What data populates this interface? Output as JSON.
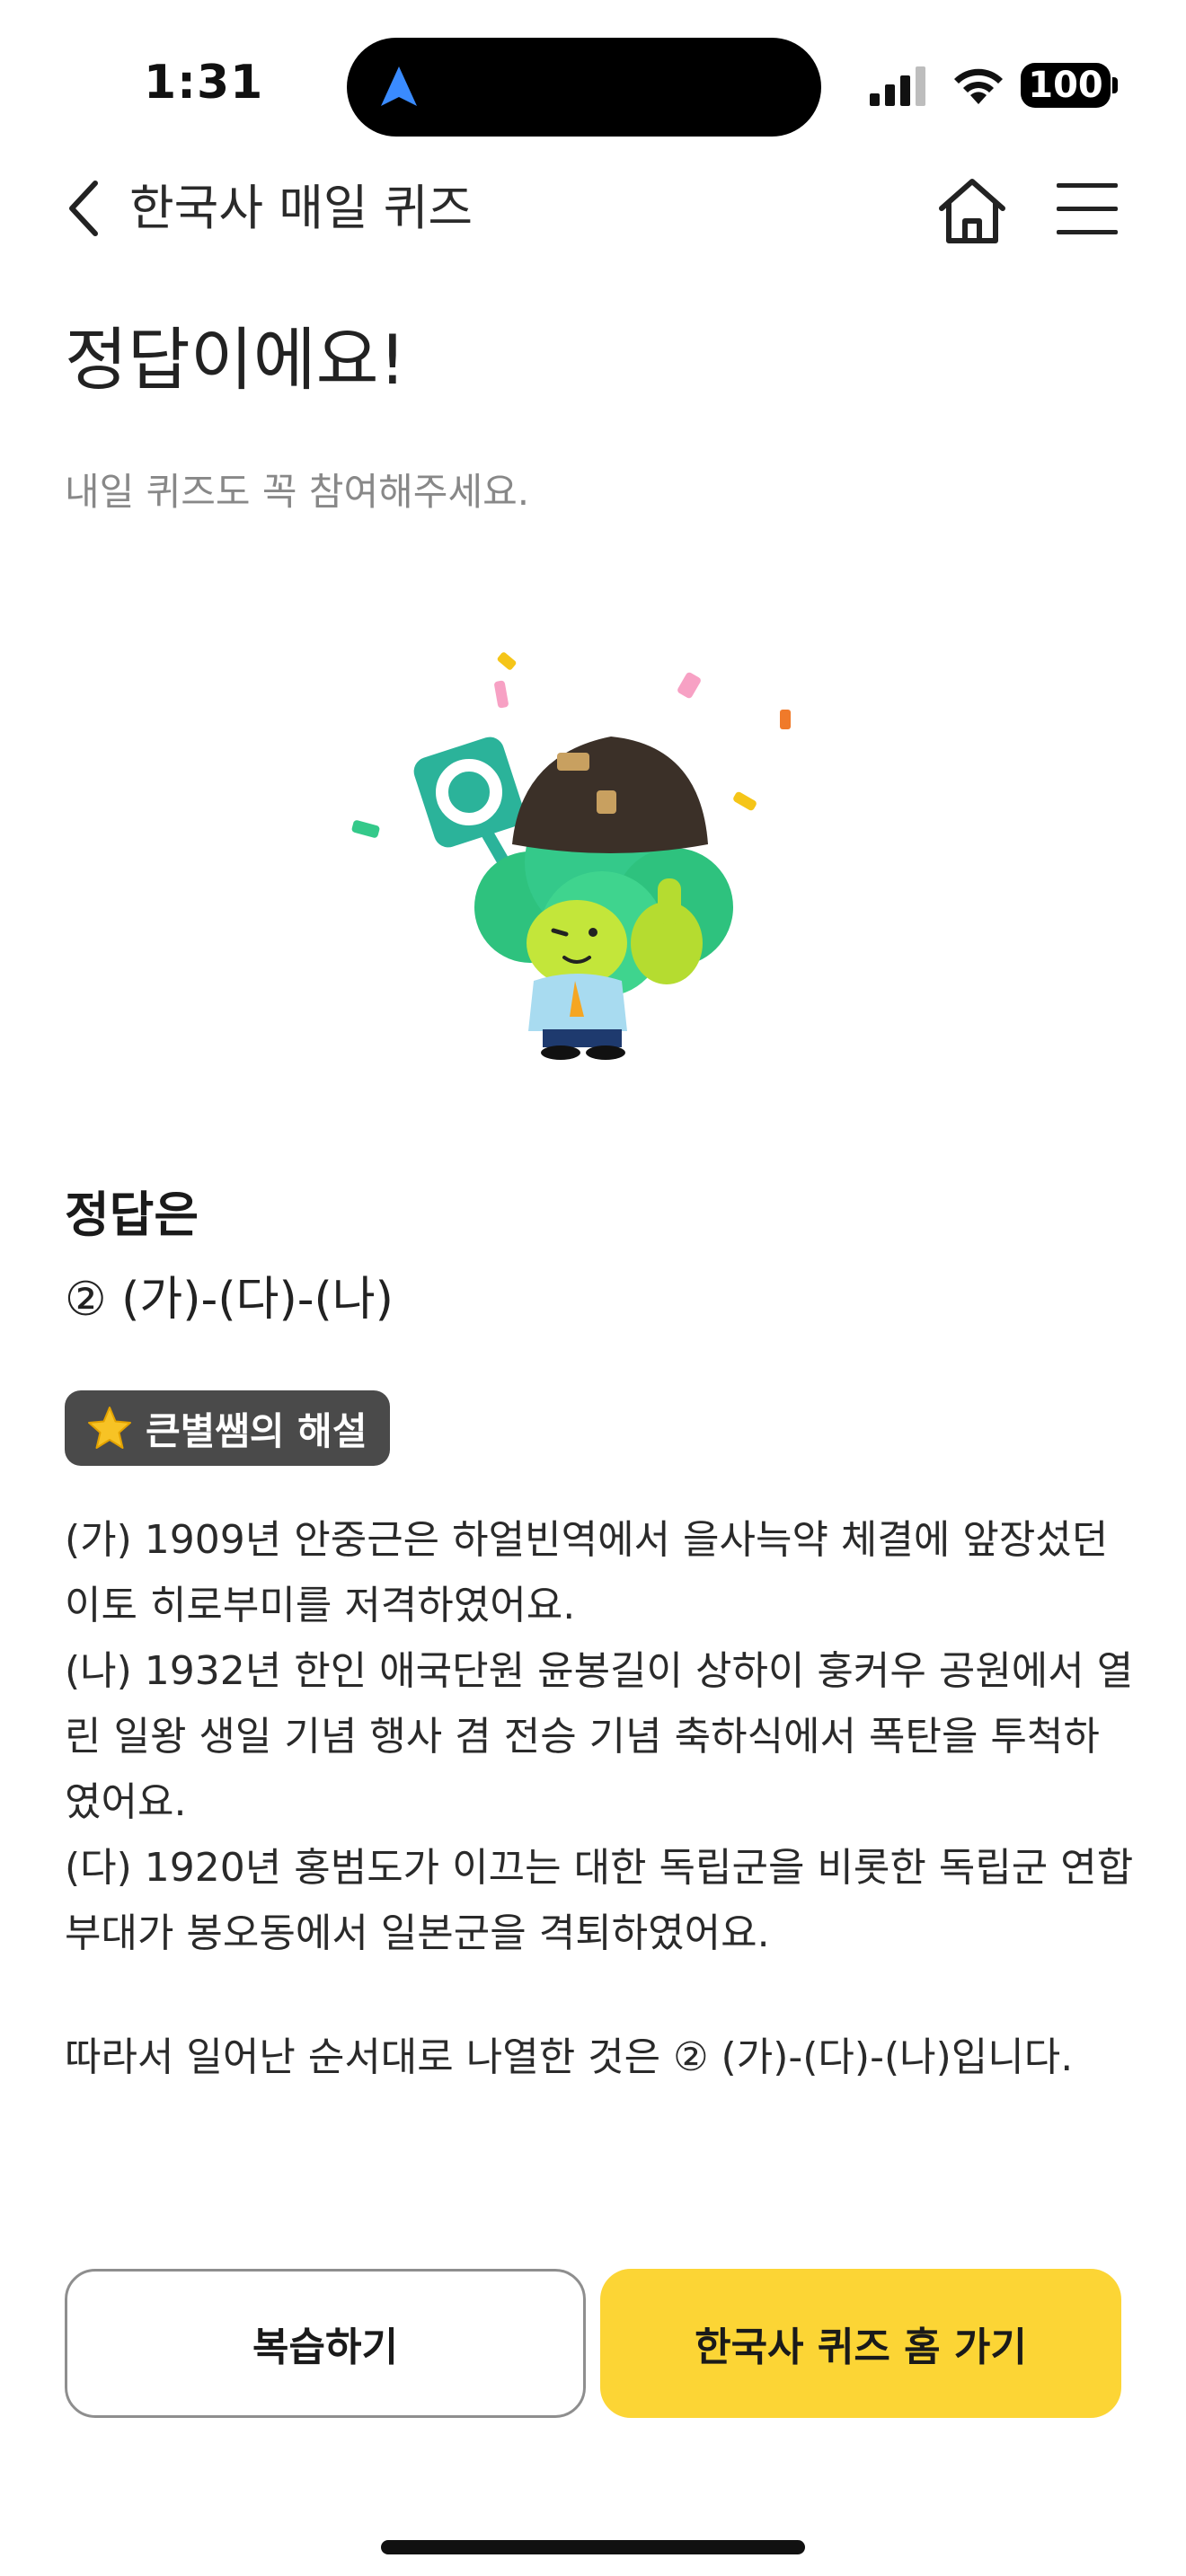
{
  "status_bar": {
    "time": "1:31",
    "battery": "100",
    "icons": [
      "navigation-arrow-icon",
      "signal-bars-icon",
      "wifi-icon",
      "battery-icon"
    ]
  },
  "header": {
    "title": "한국사 매일 퀴즈",
    "icons": [
      "chevron-left-icon",
      "home-icon",
      "hamburger-menu-icon"
    ]
  },
  "result": {
    "title": "정답이에요!",
    "subtitle": "내일 퀴즈도 꼭 참여해주세요."
  },
  "answer": {
    "label": "정답은",
    "value": "② (가)-(다)-(나)"
  },
  "explanation": {
    "badge_label": "큰별쌤의 해설",
    "badge_icon": "star-icon",
    "lines": [
      "(가) 1909년 안중근은 하얼빈역에서 을사늑약 체결에 앞장섰던 이토 히로부미를 저격하였어요.",
      "(나) 1932년 한인 애국단원 윤봉길이 상하이 훙커우 공원에서 열린 일왕 생일 기념 행사 겸 전승 기념 축하식에서 폭탄을 투척하였어요.",
      "(다) 1920년 홍범도가 이끄는 대한 독립군을 비롯한 독립군 연합 부대가 봉오동에서 일본군을 격퇴하였어요."
    ],
    "conclusion": "따라서 일어난 순서대로 나열한 것은 ② (가)-(다)-(나)입니다."
  },
  "buttons": {
    "review": "복습하기",
    "home": "한국사 퀴즈 홈 가기"
  },
  "colors": {
    "accent": "#fcd535",
    "badge_bg": "#4a4a4a",
    "subtitle": "#888888",
    "mascot_green": "#2ec27e"
  }
}
